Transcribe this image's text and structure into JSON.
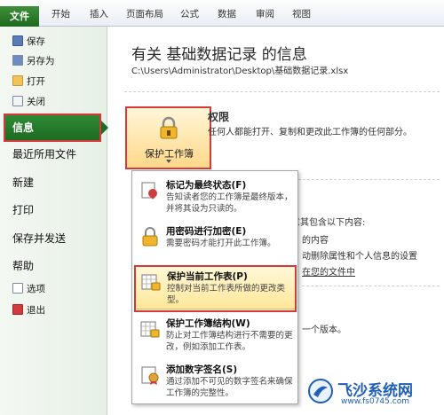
{
  "ribbon": {
    "file_tab": "文件",
    "tabs": [
      "开始",
      "插入",
      "页面布局",
      "公式",
      "数据",
      "审阅",
      "视图"
    ]
  },
  "backstage_nav": {
    "small_items": [
      {
        "label": "保存",
        "icon": "save-icon"
      },
      {
        "label": "另存为",
        "icon": "save-as-icon"
      },
      {
        "label": "打开",
        "icon": "open-folder-icon"
      },
      {
        "label": "关闭",
        "icon": "close-doc-icon"
      }
    ],
    "info": "信息",
    "large_items": [
      "最近所用文件",
      "新建",
      "打印",
      "保存并发送",
      "帮助"
    ],
    "bottom_items": [
      {
        "label": "选项",
        "icon": "options-icon"
      },
      {
        "label": "退出",
        "icon": "exit-icon"
      }
    ]
  },
  "main": {
    "title": "有关 基础数据记录 的信息",
    "path": "C:\\Users\\Administrator\\Desktop\\基础数据记录.xlsx",
    "permissions": {
      "button_label": "保护工作簿",
      "heading": "权限",
      "description": "任何人都能打开、复制和更改此工作簿的任何部分。"
    },
    "inspect": {
      "line1": "意其包含以下内容:",
      "line2": "的内容",
      "line3": "动删除属性和个人信息的设置",
      "line4": "在您的文件中"
    },
    "versions": {
      "text": "一个版本。"
    }
  },
  "protect_menu": {
    "items": [
      {
        "title": "标记为最终状态(F)",
        "desc": "告知读者您的工作簿是最终版本，并将其设为只读的。",
        "icon": "final-mark-icon"
      },
      {
        "title": "用密码进行加密(E)",
        "desc": "需要密码才能打开此工作簿。",
        "icon": "encrypt-lock-icon"
      },
      {
        "title": "保护当前工作表(P)",
        "desc": "控制对当前工作表所做的更改类型。",
        "icon": "protect-sheet-icon"
      },
      {
        "title": "保护工作簿结构(W)",
        "desc": "防止对工作簿结构进行不需要的更改，例如添加工作表。",
        "icon": "protect-structure-icon"
      },
      {
        "title": "添加数字签名(S)",
        "desc": "通过添加不可见的数字签名来确保工作簿的完整性。",
        "icon": "digital-signature-icon"
      }
    ]
  },
  "watermark": {
    "title": "飞沙系统网",
    "url": "www.fs0745.com"
  },
  "colors": {
    "file_tab": "#2a7d2e",
    "selection_border": "#d43a3a",
    "highlight": "#ffe79a"
  }
}
